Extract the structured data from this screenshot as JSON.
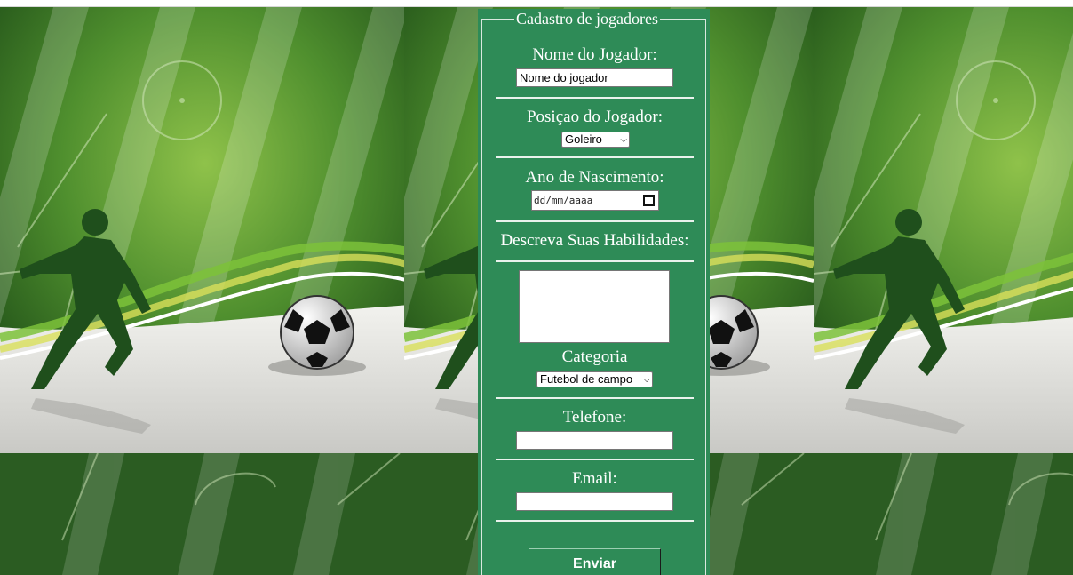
{
  "form": {
    "legend": "Cadastro de jogadores",
    "name_label": "Nome do Jogador:",
    "name_value": "Nome do jogador",
    "position_label": "Posiçao do Jogador:",
    "position_selected": "Goleiro",
    "birth_label": "Ano de Nascimento:",
    "birth_placeholder": "dd/mm/aaaa",
    "skills_label": "Descreva Suas Habilidades:",
    "category_label": "Categoria",
    "category_selected": "Futebol de campo",
    "phone_label": "Telefone:",
    "email_label": "Email:",
    "submit_label": "Enviar"
  },
  "colors": {
    "panel": "#2e8b57",
    "field_dark": "#2f6a24",
    "field_light": "#5c9a35"
  },
  "icons": [
    "calendar-icon",
    "chevron-down-icon",
    "soccer-ball-icon",
    "player-silhouette-icon"
  ]
}
